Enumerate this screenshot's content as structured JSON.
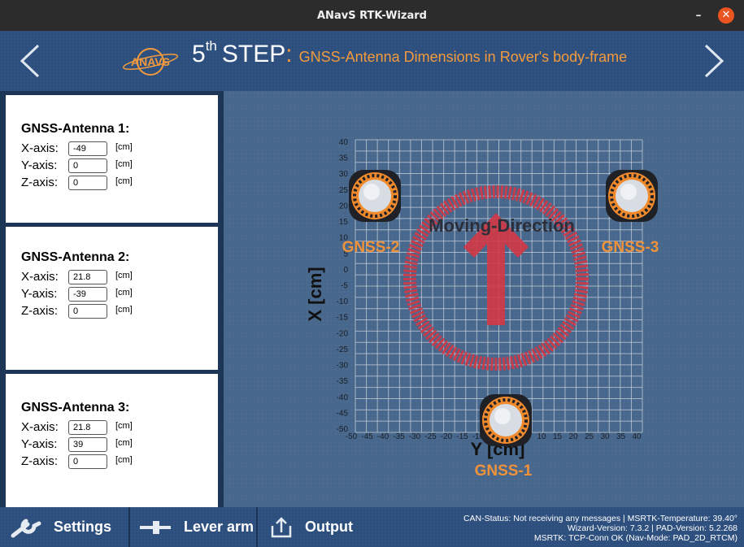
{
  "window": {
    "title": "ANavS RTK-Wizard",
    "minimize": "–",
    "close": "✕"
  },
  "header": {
    "logo_text": "ANAVS",
    "step_number": "5",
    "step_suffix": "th",
    "step_word": "STEP",
    "step_colon": ":",
    "step_description": "GNSS-Antenna Dimensions in Rover's body-frame"
  },
  "antennas": [
    {
      "title": "GNSS-Antenna 1:",
      "x_label": "X-axis:",
      "x": "-49",
      "y_label": "Y-axis:",
      "y": "0",
      "z_label": "Z-axis:",
      "z": "0",
      "unit": "[cm]"
    },
    {
      "title": "GNSS-Antenna 2:",
      "x_label": "X-axis:",
      "x": "21.8",
      "y_label": "Y-axis:",
      "y": "-39",
      "z_label": "Z-axis:",
      "z": "0",
      "unit": "[cm]"
    },
    {
      "title": "GNSS-Antenna 3:",
      "x_label": "X-axis:",
      "x": "21.8",
      "y_label": "Y-axis:",
      "y": "39",
      "z_label": "Z-axis:",
      "z": "0",
      "unit": "[cm]"
    }
  ],
  "plot": {
    "moving_direction_label": "Moving-Direction",
    "x_axis_label": "X [cm]",
    "y_axis_label": "Y [cm]",
    "ticks": [
      "-50",
      "-45",
      "-40",
      "-35",
      "-30",
      "-25",
      "-20",
      "-15",
      "-10",
      "-5",
      "0",
      "5",
      "10",
      "15",
      "20",
      "25",
      "30",
      "35",
      "40"
    ],
    "antenna_labels": [
      "GNSS-1",
      "GNSS-2",
      "GNSS-3"
    ],
    "colors": {
      "antenna_label": "#f0923a",
      "arrow": "#d03a47",
      "grid": "#c7cfd9"
    }
  },
  "footer": {
    "settings_label": "Settings",
    "lever_arm_label": "Lever arm",
    "output_label": "Output",
    "status_line1": "CAN-Status: Not receiving any messages | MSRTK-Temperature: 39.40°",
    "status_line2": "Wizard-Version: 7.3.2 | PAD-Version: 5.2.268",
    "status_line3": "MSRTK: TCP-Conn OK (Nav-Mode: PAD_2D_RTCM)"
  }
}
